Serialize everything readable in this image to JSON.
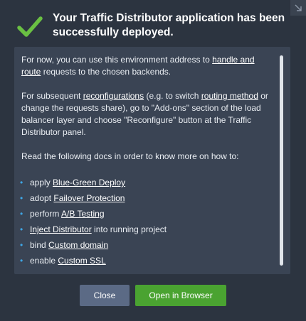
{
  "dialog": {
    "title": "Your Traffic Distributor application has been successfully deployed.",
    "icons": {
      "status": "checkmark-icon",
      "corner": "collapse-arrow-icon"
    },
    "colors": {
      "check": "#6ac043",
      "bullet": "#3fa7e6",
      "open_button": "#4aa331",
      "close_button": "#5b6a85"
    }
  },
  "content": {
    "p1": {
      "before": "For now, you can use this environment address to ",
      "link1": "handle and route",
      "after": " requests to the chosen backends."
    },
    "p2": {
      "before": "For subsequent ",
      "link1": "reconfigurations",
      "middle": " (e.g. to switch ",
      "link2": "routing method",
      "after": " or change the requests share), go to \"Add-ons\" section of the load balancer layer and choose \"Reconfigure\" button at the Traffic Distributor panel."
    },
    "p3": "Read the following docs in order to know more on how to:",
    "docs": [
      {
        "bullet": "•",
        "before": "apply ",
        "link": "Blue-Green Deploy",
        "after": ""
      },
      {
        "bullet": "•",
        "before": "adopt ",
        "link": "Failover Protection",
        "after": ""
      },
      {
        "bullet": "•",
        "before": "perform ",
        "link": "A/B Testing",
        "after": ""
      },
      {
        "bullet": "•",
        "before": "",
        "link": "Inject Distributor",
        "after": " into running project"
      },
      {
        "bullet": "•",
        "before": "bind ",
        "link": "Custom domain",
        "after": ""
      },
      {
        "bullet": "•",
        "before": "enable ",
        "link": "Custom SSL",
        "after": ""
      }
    ]
  },
  "buttons": {
    "close": "Close",
    "open": "Open in Browser"
  }
}
